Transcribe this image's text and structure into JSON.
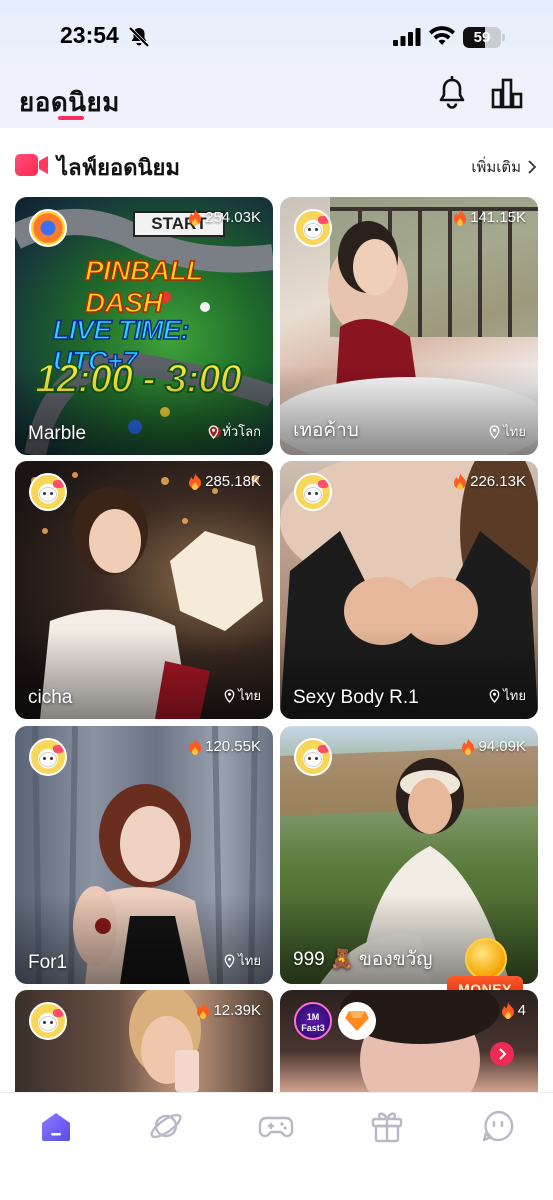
{
  "status_bar": {
    "time": "23:54",
    "battery": "59",
    "battery_level": 0.59,
    "icons": [
      "mute-bell-icon",
      "cellular-signal-icon",
      "wifi-icon",
      "battery-icon"
    ]
  },
  "header": {
    "title": "ยอดนิยม",
    "accent_color": "#ff2d5e",
    "icons": [
      "bell-icon",
      "ranking-icon"
    ]
  },
  "section": {
    "title": "ไลฟ์ยอดนิยม",
    "more_label": "เพิ่มเติม",
    "icon": "live-camera-icon"
  },
  "cards": [
    {
      "name": "Marble",
      "viewers": "254.03K",
      "location": "ทั่วโลก"
    },
    {
      "name": "เทอค้าบ",
      "viewers": "141.15K",
      "location": "ไทย"
    },
    {
      "name": "cicha",
      "viewers": "285.18K",
      "location": "ไทย"
    },
    {
      "name": "Sexy Body R.1",
      "viewers": "226.13K",
      "location": "ไทย"
    },
    {
      "name": "For1",
      "viewers": "120.55K",
      "location": "ไทย"
    },
    {
      "name": "999 🧸 ของขวัญ",
      "viewers": "94.09K",
      "location": ""
    },
    {
      "name": "",
      "viewers": "12.39K",
      "location": ""
    },
    {
      "name": "",
      "viewers": "4",
      "location": ""
    }
  ],
  "pinball": {
    "start": "START",
    "title": "PINBALL DASH",
    "live_time": "LIVE TIME: UTC+7",
    "hours": "12:00 - 3:00"
  },
  "money_badge": {
    "label": "MONEY"
  },
  "fast_badge": {
    "label": "1M Fast3"
  },
  "bottom_nav": {
    "items": [
      "home-icon",
      "planet-icon",
      "gamepad-icon",
      "gift-icon",
      "chat-face-icon"
    ],
    "active_color": "#6b5cf0",
    "inactive_color": "#b8b8c6"
  }
}
